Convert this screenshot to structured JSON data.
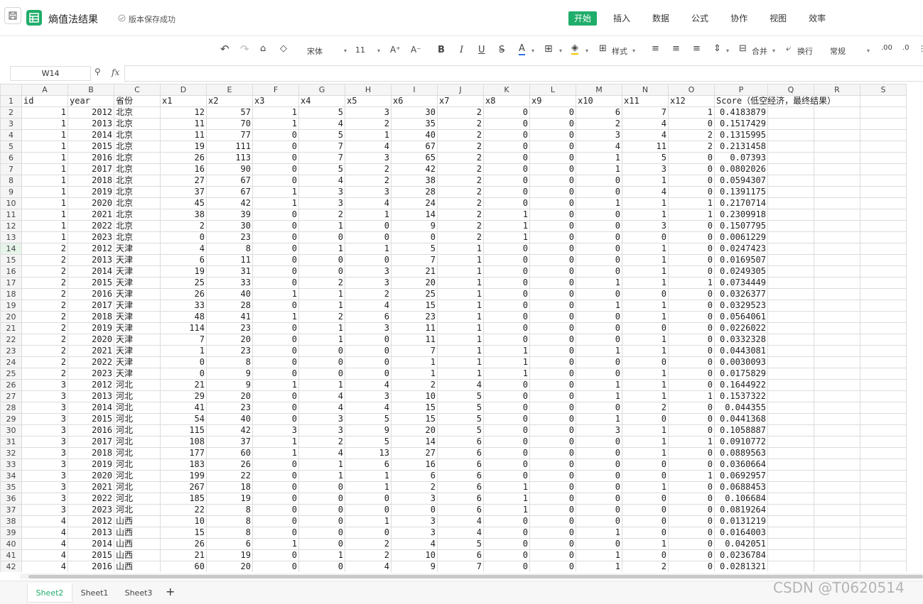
{
  "app": {
    "doc_title": "熵值法结果",
    "save_status": "版本保存成功",
    "menu": [
      "开始",
      "插入",
      "数据",
      "公式",
      "协作",
      "视图",
      "效率"
    ],
    "menu_active": "开始",
    "accent": "#1fad6a"
  },
  "toolbar": {
    "font_name": "宋体",
    "font_size": "11",
    "style_label": "样式",
    "merge_label": "合并",
    "wrap_label": "换行",
    "format_label": "常规",
    "bold": "B",
    "italic": "I",
    "underline": "U",
    "strike": "S",
    "font_color": "A",
    "grow": "A⁺",
    "shrink": "A⁻"
  },
  "formula": {
    "namebox": "W14",
    "fx": "fx",
    "value": ""
  },
  "grid": {
    "columns": [
      "A",
      "B",
      "C",
      "D",
      "E",
      "F",
      "G",
      "H",
      "I",
      "J",
      "K",
      "L",
      "M",
      "N",
      "O",
      "P",
      "Q",
      "R",
      "S"
    ],
    "selected_row": 14,
    "header": [
      "id",
      "year",
      "省份",
      "x1",
      "x2",
      "x3",
      "x4",
      "x5",
      "x6",
      "x7",
      "x8",
      "x9",
      "x10",
      "x11",
      "x12",
      "Score（低空经济，最终结果）"
    ],
    "rows": [
      [
        "1",
        "2012",
        "北京",
        "12",
        "57",
        "1",
        "5",
        "3",
        "30",
        "2",
        "0",
        "0",
        "6",
        "7",
        "1",
        "0.4183879"
      ],
      [
        "1",
        "2013",
        "北京",
        "11",
        "70",
        "1",
        "4",
        "2",
        "35",
        "2",
        "0",
        "0",
        "2",
        "4",
        "0",
        "0.1517429"
      ],
      [
        "1",
        "2014",
        "北京",
        "11",
        "77",
        "0",
        "5",
        "1",
        "40",
        "2",
        "0",
        "0",
        "3",
        "4",
        "2",
        "0.1315995"
      ],
      [
        "1",
        "2015",
        "北京",
        "19",
        "111",
        "0",
        "7",
        "4",
        "67",
        "2",
        "0",
        "0",
        "4",
        "11",
        "2",
        "0.2131458"
      ],
      [
        "1",
        "2016",
        "北京",
        "26",
        "113",
        "0",
        "7",
        "3",
        "65",
        "2",
        "0",
        "0",
        "1",
        "5",
        "0",
        "0.07393"
      ],
      [
        "1",
        "2017",
        "北京",
        "16",
        "90",
        "0",
        "5",
        "2",
        "42",
        "2",
        "0",
        "0",
        "1",
        "3",
        "0",
        "0.0802026"
      ],
      [
        "1",
        "2018",
        "北京",
        "27",
        "67",
        "0",
        "4",
        "2",
        "38",
        "2",
        "0",
        "0",
        "0",
        "1",
        "0",
        "0.0594307"
      ],
      [
        "1",
        "2019",
        "北京",
        "37",
        "67",
        "1",
        "3",
        "3",
        "28",
        "2",
        "0",
        "0",
        "0",
        "4",
        "0",
        "0.1391175"
      ],
      [
        "1",
        "2020",
        "北京",
        "45",
        "42",
        "1",
        "3",
        "4",
        "24",
        "2",
        "0",
        "0",
        "1",
        "1",
        "1",
        "0.2170714"
      ],
      [
        "1",
        "2021",
        "北京",
        "38",
        "39",
        "0",
        "2",
        "1",
        "14",
        "2",
        "1",
        "0",
        "0",
        "1",
        "1",
        "0.2309918"
      ],
      [
        "1",
        "2022",
        "北京",
        "2",
        "30",
        "0",
        "1",
        "0",
        "9",
        "2",
        "1",
        "0",
        "0",
        "3",
        "0",
        "0.1507795"
      ],
      [
        "1",
        "2023",
        "北京",
        "0",
        "23",
        "0",
        "0",
        "0",
        "0",
        "2",
        "1",
        "0",
        "0",
        "0",
        "0",
        "0.0061229"
      ],
      [
        "2",
        "2012",
        "天津",
        "4",
        "8",
        "0",
        "1",
        "1",
        "5",
        "1",
        "0",
        "0",
        "0",
        "1",
        "0",
        "0.0247423"
      ],
      [
        "2",
        "2013",
        "天津",
        "6",
        "11",
        "0",
        "0",
        "0",
        "7",
        "1",
        "0",
        "0",
        "0",
        "1",
        "0",
        "0.0169507"
      ],
      [
        "2",
        "2014",
        "天津",
        "19",
        "31",
        "0",
        "0",
        "3",
        "21",
        "1",
        "0",
        "0",
        "0",
        "1",
        "0",
        "0.0249305"
      ],
      [
        "2",
        "2015",
        "天津",
        "25",
        "33",
        "0",
        "2",
        "3",
        "20",
        "1",
        "0",
        "0",
        "1",
        "1",
        "1",
        "0.0734449"
      ],
      [
        "2",
        "2016",
        "天津",
        "26",
        "40",
        "1",
        "1",
        "2",
        "25",
        "1",
        "0",
        "0",
        "0",
        "0",
        "0",
        "0.0326377"
      ],
      [
        "2",
        "2017",
        "天津",
        "33",
        "28",
        "0",
        "1",
        "4",
        "15",
        "1",
        "0",
        "0",
        "1",
        "1",
        "0",
        "0.0329523"
      ],
      [
        "2",
        "2018",
        "天津",
        "48",
        "41",
        "1",
        "2",
        "6",
        "23",
        "1",
        "0",
        "0",
        "0",
        "1",
        "0",
        "0.0564061"
      ],
      [
        "2",
        "2019",
        "天津",
        "114",
        "23",
        "0",
        "1",
        "3",
        "11",
        "1",
        "0",
        "0",
        "0",
        "0",
        "0",
        "0.0226022"
      ],
      [
        "2",
        "2020",
        "天津",
        "7",
        "20",
        "0",
        "1",
        "0",
        "11",
        "1",
        "0",
        "0",
        "0",
        "1",
        "0",
        "0.0332328"
      ],
      [
        "2",
        "2021",
        "天津",
        "1",
        "23",
        "0",
        "0",
        "0",
        "7",
        "1",
        "1",
        "0",
        "1",
        "1",
        "0",
        "0.0443081"
      ],
      [
        "2",
        "2022",
        "天津",
        "0",
        "8",
        "0",
        "0",
        "0",
        "1",
        "1",
        "1",
        "0",
        "0",
        "0",
        "0",
        "0.0030093"
      ],
      [
        "2",
        "2023",
        "天津",
        "0",
        "9",
        "0",
        "0",
        "0",
        "1",
        "1",
        "1",
        "0",
        "0",
        "1",
        "0",
        "0.0175829"
      ],
      [
        "3",
        "2012",
        "河北",
        "21",
        "9",
        "1",
        "1",
        "4",
        "2",
        "4",
        "0",
        "0",
        "1",
        "1",
        "0",
        "0.1644922"
      ],
      [
        "3",
        "2013",
        "河北",
        "29",
        "20",
        "0",
        "4",
        "3",
        "10",
        "5",
        "0",
        "0",
        "1",
        "1",
        "1",
        "0.1537322"
      ],
      [
        "3",
        "2014",
        "河北",
        "41",
        "23",
        "0",
        "4",
        "4",
        "15",
        "5",
        "0",
        "0",
        "0",
        "2",
        "0",
        "0.044355"
      ],
      [
        "3",
        "2015",
        "河北",
        "54",
        "40",
        "0",
        "3",
        "5",
        "15",
        "5",
        "0",
        "0",
        "1",
        "0",
        "0",
        "0.0441368"
      ],
      [
        "3",
        "2016",
        "河北",
        "115",
        "42",
        "3",
        "3",
        "9",
        "20",
        "5",
        "0",
        "0",
        "3",
        "1",
        "0",
        "0.1058887"
      ],
      [
        "3",
        "2017",
        "河北",
        "108",
        "37",
        "1",
        "2",
        "5",
        "14",
        "6",
        "0",
        "0",
        "0",
        "1",
        "1",
        "0.0910772"
      ],
      [
        "3",
        "2018",
        "河北",
        "177",
        "60",
        "1",
        "4",
        "13",
        "27",
        "6",
        "0",
        "0",
        "0",
        "1",
        "0",
        "0.0889563"
      ],
      [
        "3",
        "2019",
        "河北",
        "183",
        "26",
        "0",
        "1",
        "6",
        "16",
        "6",
        "0",
        "0",
        "0",
        "0",
        "0",
        "0.0360664"
      ],
      [
        "3",
        "2020",
        "河北",
        "199",
        "22",
        "0",
        "1",
        "1",
        "6",
        "6",
        "0",
        "0",
        "0",
        "0",
        "1",
        "0.0692957"
      ],
      [
        "3",
        "2021",
        "河北",
        "267",
        "18",
        "0",
        "0",
        "1",
        "2",
        "6",
        "1",
        "0",
        "0",
        "1",
        "0",
        "0.0688453"
      ],
      [
        "3",
        "2022",
        "河北",
        "185",
        "19",
        "0",
        "0",
        "0",
        "3",
        "6",
        "1",
        "0",
        "0",
        "0",
        "0",
        "0.106684"
      ],
      [
        "3",
        "2023",
        "河北",
        "22",
        "8",
        "0",
        "0",
        "0",
        "0",
        "6",
        "1",
        "0",
        "0",
        "0",
        "0",
        "0.0819264"
      ],
      [
        "4",
        "2012",
        "山西",
        "10",
        "8",
        "0",
        "0",
        "1",
        "3",
        "4",
        "0",
        "0",
        "0",
        "0",
        "0",
        "0.0131219"
      ],
      [
        "4",
        "2013",
        "山西",
        "15",
        "8",
        "0",
        "0",
        "0",
        "3",
        "4",
        "0",
        "0",
        "1",
        "0",
        "0",
        "0.0164003"
      ],
      [
        "4",
        "2014",
        "山西",
        "26",
        "6",
        "1",
        "0",
        "2",
        "4",
        "5",
        "0",
        "0",
        "0",
        "1",
        "0",
        "0.042051"
      ],
      [
        "4",
        "2015",
        "山西",
        "21",
        "19",
        "0",
        "1",
        "2",
        "10",
        "6",
        "0",
        "0",
        "1",
        "0",
        "0",
        "0.0236784"
      ],
      [
        "4",
        "2016",
        "山西",
        "60",
        "20",
        "0",
        "0",
        "4",
        "9",
        "7",
        "0",
        "0",
        "1",
        "2",
        "0",
        "0.0281321"
      ]
    ]
  },
  "sheets": [
    "Sheet2",
    "Sheet1",
    "Sheet3"
  ],
  "active_sheet": "Sheet2",
  "add_sheet": "+",
  "watermark": "CSDN @T0620514"
}
